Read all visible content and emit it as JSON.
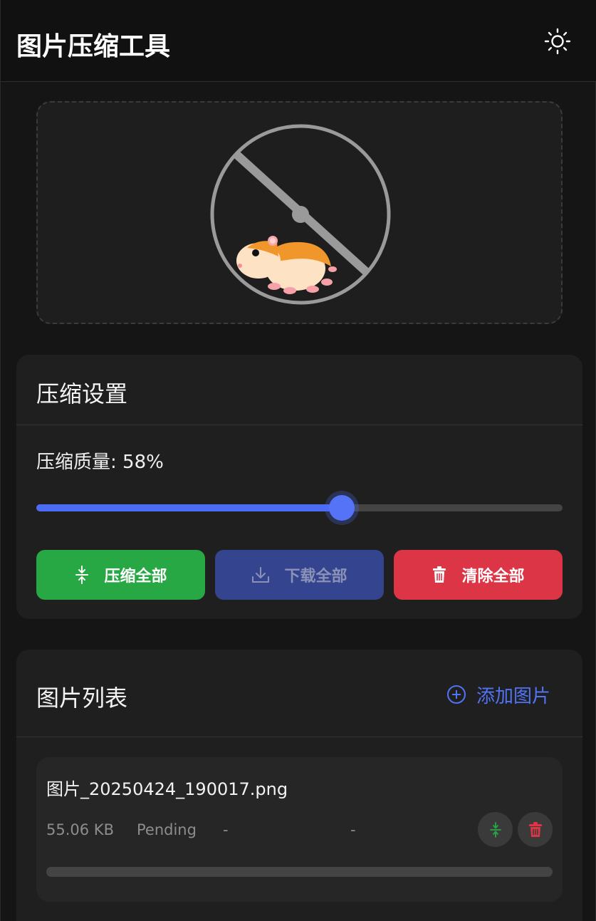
{
  "header": {
    "title": "图片压缩工具",
    "theme_icon": "sun-icon"
  },
  "dropzone": {
    "illustration": "hamster-wheel-illustration"
  },
  "settings": {
    "title": "压缩设置",
    "quality_label": "压缩质量: 58%",
    "quality_value": 58,
    "buttons": {
      "compress_all": "压缩全部",
      "download_all": "下载全部",
      "clear_all": "清除全部"
    }
  },
  "image_list": {
    "title": "图片列表",
    "add_label": "添加图片",
    "items": [
      {
        "name": "图片_20250424_190017.png",
        "size": "55.06 KB",
        "status": "Pending",
        "compressed_size": "-",
        "ratio": "-",
        "progress": 0
      }
    ]
  },
  "colors": {
    "accent": "#4d6cf6",
    "success": "#28a745",
    "danger": "#dc3545",
    "download_disabled": "#35448e"
  }
}
